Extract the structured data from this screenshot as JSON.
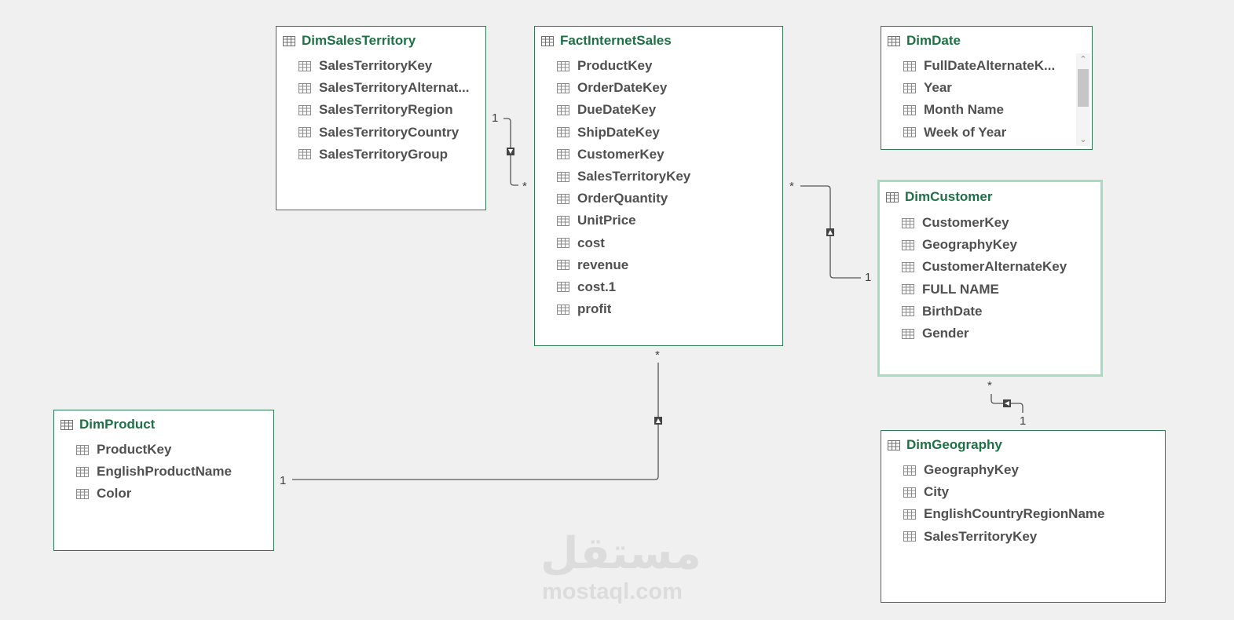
{
  "tables": {
    "dim_sales_territory": {
      "title": "DimSalesTerritory",
      "fields": [
        "SalesTerritoryKey",
        "SalesTerritoryAlternat...",
        "SalesTerritoryRegion",
        "SalesTerritoryCountry",
        "SalesTerritoryGroup"
      ]
    },
    "fact_internet_sales": {
      "title": "FactInternetSales",
      "fields": [
        "ProductKey",
        "OrderDateKey",
        "DueDateKey",
        "ShipDateKey",
        "CustomerKey",
        "SalesTerritoryKey",
        "OrderQuantity",
        "UnitPrice",
        "cost",
        "revenue",
        "cost.1",
        "profit"
      ]
    },
    "dim_date": {
      "title": "DimDate",
      "fields": [
        "FullDateAlternateK...",
        "Year",
        "Month Name",
        "Week of Year"
      ]
    },
    "dim_customer": {
      "title": "DimCustomer",
      "fields": [
        "CustomerKey",
        "GeographyKey",
        "CustomerAlternateKey",
        "FULL NAME",
        "BirthDate",
        "Gender"
      ]
    },
    "dim_product": {
      "title": "DimProduct",
      "fields": [
        "ProductKey",
        "EnglishProductName",
        "Color"
      ]
    },
    "dim_geography": {
      "title": "DimGeography",
      "fields": [
        "GeographyKey",
        "City",
        "EnglishCountryRegionName",
        "SalesTerritoryKey"
      ]
    }
  },
  "relationships": {
    "territory_fact": {
      "one": "1",
      "many": "*"
    },
    "fact_customer": {
      "one": "1",
      "many": "*"
    },
    "fact_product": {
      "one": "1",
      "many": "*"
    },
    "customer_geography": {
      "one": "1",
      "many": "*"
    }
  },
  "colors": {
    "title": "#1e7145",
    "border": "#2f7a52",
    "selected_border": "#a6dcc0",
    "background": "#f0f0f0"
  },
  "watermark": {
    "arabic": "مستقل",
    "latin": "mostaql.com"
  }
}
